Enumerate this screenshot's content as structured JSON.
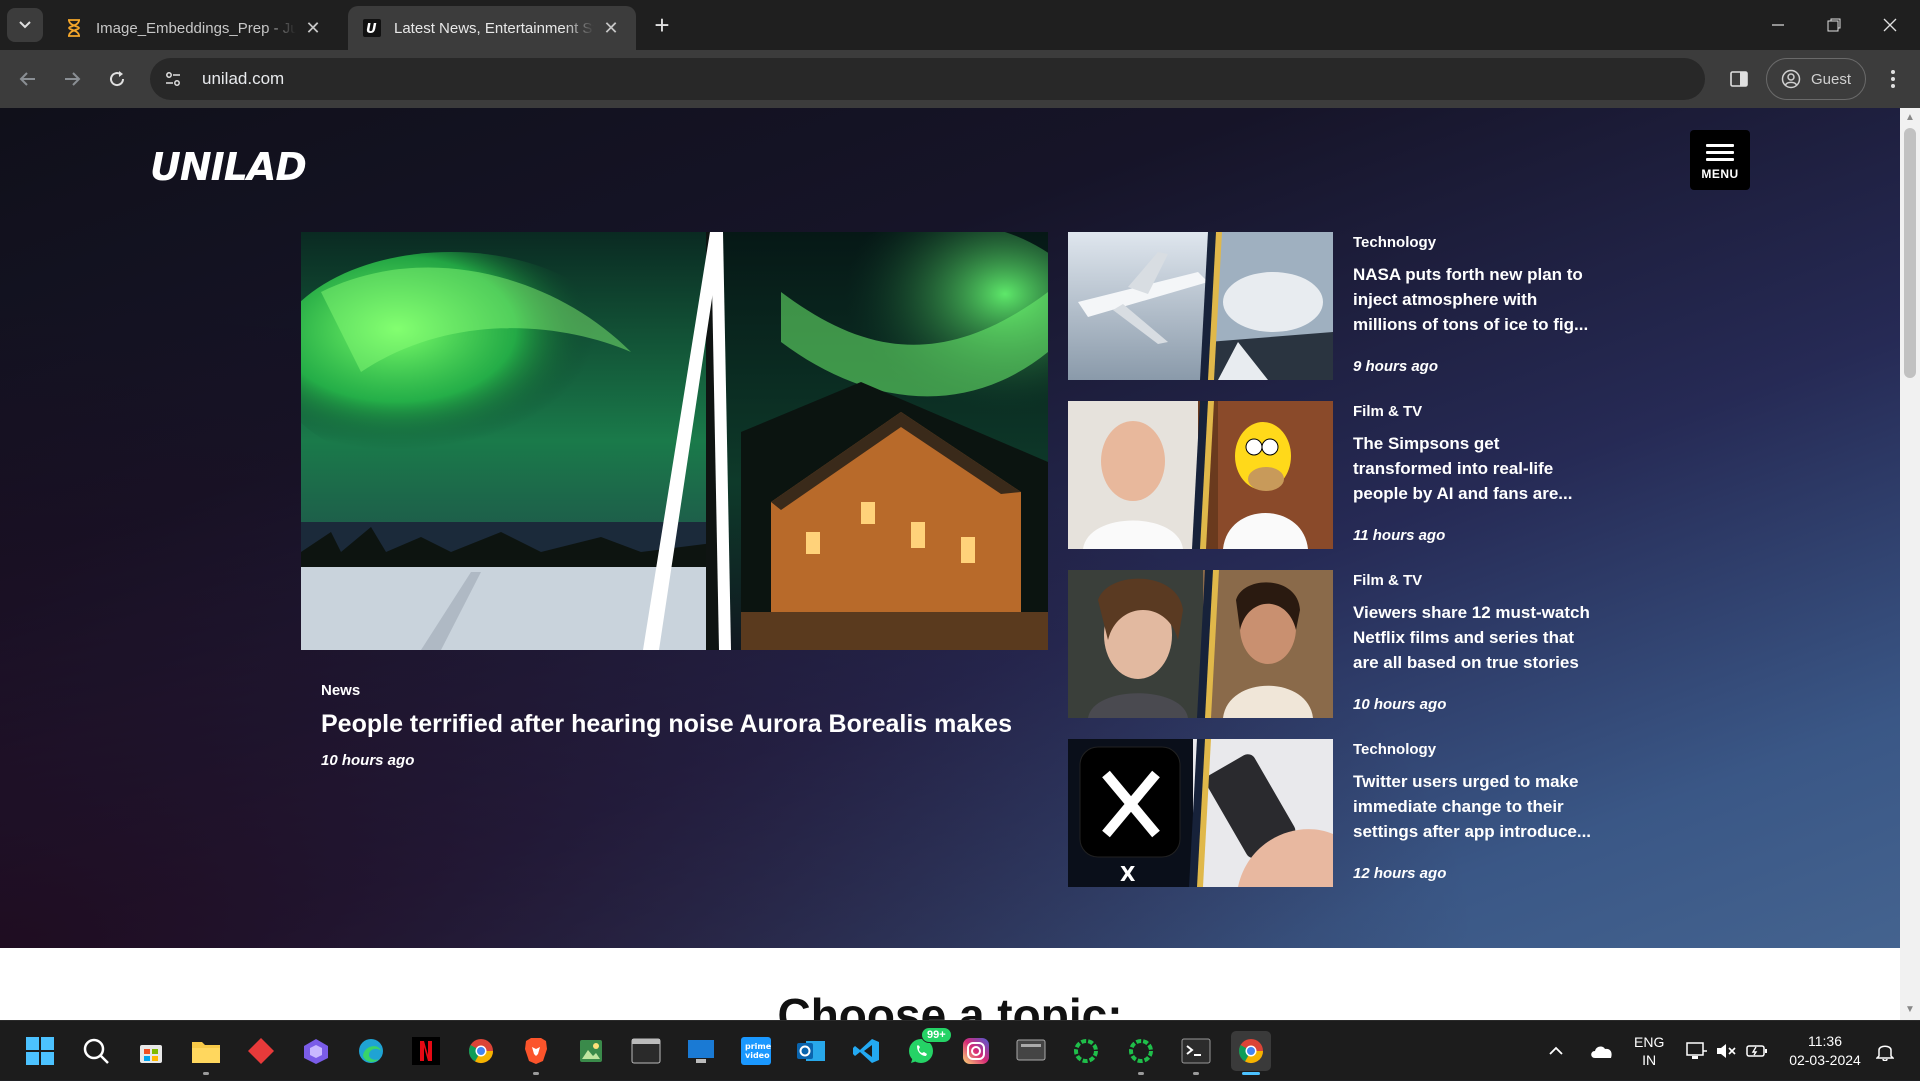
{
  "browser": {
    "tabs": [
      {
        "title": "Image_Embeddings_Prep - Jupyter",
        "icon": "hourglass-icon",
        "active": false
      },
      {
        "title": "Latest News, Entertainment Stories",
        "icon": "unilad-favicon",
        "active": true
      }
    ],
    "new_tab_label": "+",
    "url": "unilad.com",
    "profile_label": "Guest"
  },
  "site": {
    "logo_text": "UNILAD",
    "menu_label": "MENU",
    "main_story": {
      "category": "News",
      "title": "People terrified after hearing noise Aurora Borealis makes",
      "time": "10 hours ago"
    },
    "side_stories": [
      {
        "category": "Technology",
        "title": "NASA puts forth new plan to inject atmosphere with millions of tons of ice to fig...",
        "time": "9 hours ago"
      },
      {
        "category": "Film & TV",
        "title": "The Simpsons get transformed into real-life people by AI and fans are...",
        "time": "11 hours ago"
      },
      {
        "category": "Film & TV",
        "title": "Viewers share 12 must-watch Netflix films and series that are all based on true stories",
        "time": "10 hours ago"
      },
      {
        "category": "Technology",
        "title": "Twitter users urged to make immediate change to their settings after app introduce...",
        "time": "12 hours ago"
      }
    ],
    "topics_heading": "Choose a topic:"
  },
  "taskbar": {
    "whatsapp_badge": "99+",
    "language": {
      "line1": "ENG",
      "line2": "IN"
    },
    "time": "11:36",
    "date": "02-03-2024"
  },
  "colors": {
    "chrome_dark": "#1f1f1f",
    "chrome_toolbar": "#3c3c3c",
    "hero_dark": "#12111c",
    "hero_blue": "#44638f",
    "accent_blue": "#4cc2ff"
  }
}
